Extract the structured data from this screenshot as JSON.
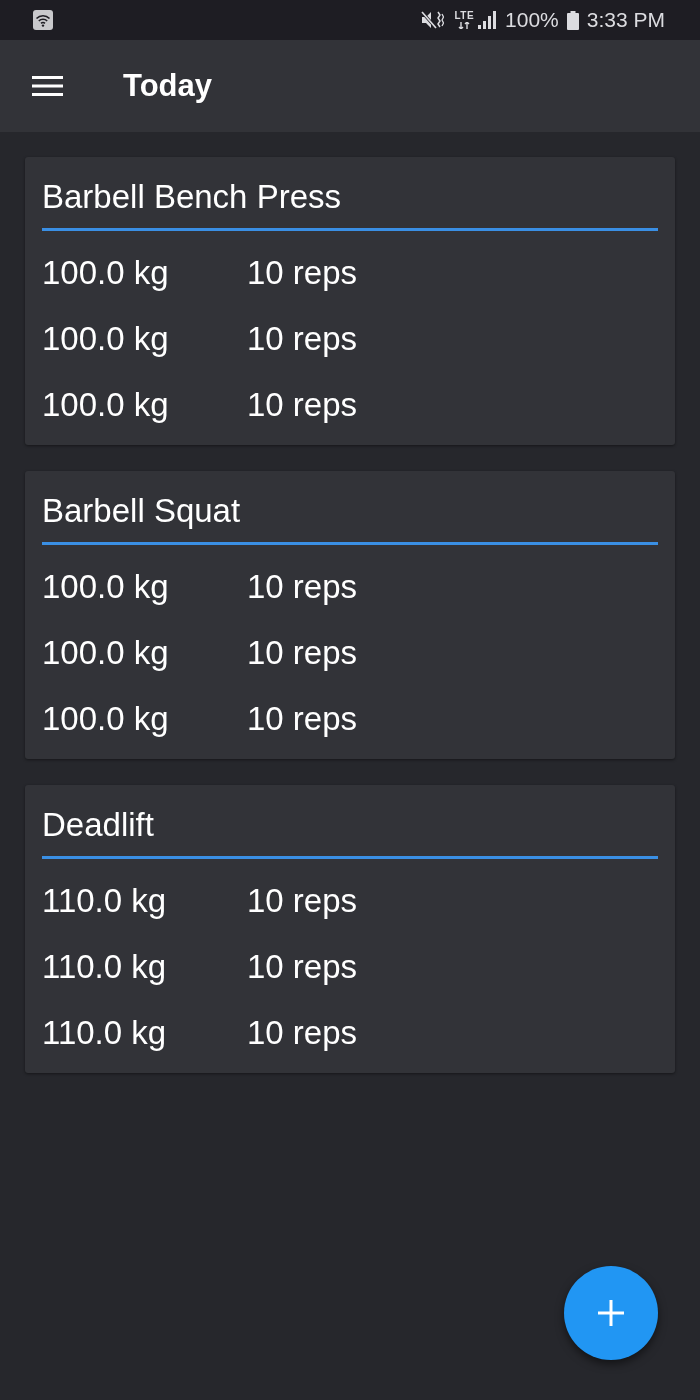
{
  "status_bar": {
    "network_type": "LTE",
    "battery": "100%",
    "time": "3:33 PM"
  },
  "app_bar": {
    "title": "Today"
  },
  "exercises": [
    {
      "name": "Barbell Bench Press",
      "sets": [
        {
          "weight": "100.0 kg",
          "reps": "10 reps"
        },
        {
          "weight": "100.0 kg",
          "reps": "10 reps"
        },
        {
          "weight": "100.0 kg",
          "reps": "10 reps"
        }
      ]
    },
    {
      "name": "Barbell Squat",
      "sets": [
        {
          "weight": "100.0 kg",
          "reps": "10 reps"
        },
        {
          "weight": "100.0 kg",
          "reps": "10 reps"
        },
        {
          "weight": "100.0 kg",
          "reps": "10 reps"
        }
      ]
    },
    {
      "name": "Deadlift",
      "sets": [
        {
          "weight": "110.0 kg",
          "reps": "10 reps"
        },
        {
          "weight": "110.0 kg",
          "reps": "10 reps"
        },
        {
          "weight": "110.0 kg",
          "reps": "10 reps"
        }
      ]
    }
  ]
}
